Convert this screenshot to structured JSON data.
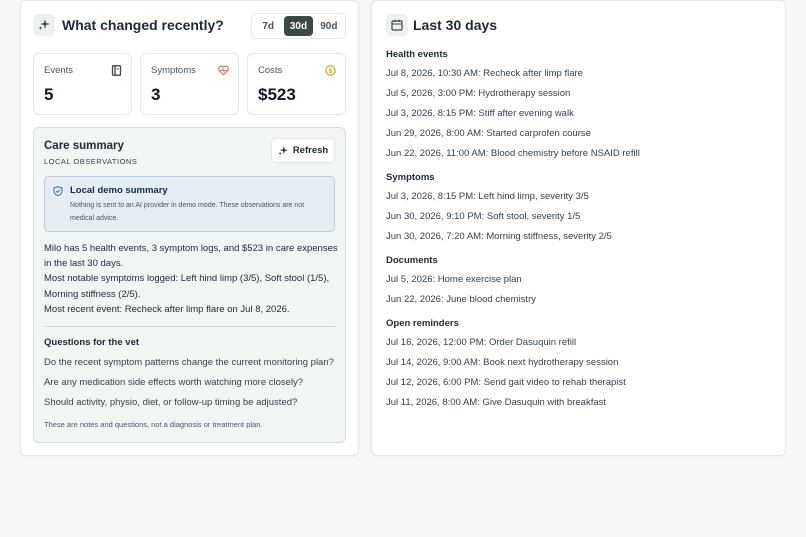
{
  "left": {
    "title": "What changed recently?",
    "range_options": [
      "7d",
      "30d",
      "90d"
    ],
    "range_selected": "30d",
    "metrics": [
      {
        "label": "Events",
        "value": "5",
        "icon": "book-icon",
        "color": "#3d4a44"
      },
      {
        "label": "Symptoms",
        "value": "3",
        "icon": "heart-pulse-icon",
        "color": "#e07a5f"
      },
      {
        "label": "Costs",
        "value": "$523",
        "icon": "coin-icon",
        "color": "#d4a017"
      }
    ],
    "care_summary": {
      "title": "Care summary",
      "subtitle": "LOCAL OBSERVATIONS",
      "refresh_label": "Refresh",
      "demo_title": "Local demo summary",
      "demo_text": "Nothing is sent to an AI provider in demo mode. These observations are not medical advice.",
      "summary_lines": [
        "Milo has 5 health events, 3 symptom logs, and $523 in care expenses in the last 30 days.",
        "Most notable symptoms logged: Left hind limp (3/5), Soft stool (1/5), Morning stiffness (2/5).",
        "Most recent event: Recheck after limp flare on Jul 8, 2026."
      ],
      "questions_title": "Questions for the vet",
      "questions": [
        "Do the recent symptom patterns change the current monitoring plan?",
        "Are any medication side effects worth watching more closely?",
        "Should activity, physio, diet, or follow-up timing be adjusted?"
      ],
      "footnote": "These are notes and questions, not a diagnosis or treatment plan."
    }
  },
  "right": {
    "title": "Last 30 days",
    "sections": [
      {
        "title": "Health events",
        "items": [
          "Jul 8, 2026, 10:30 AM: Recheck after limp flare",
          "Jul 5, 2026, 3:00 PM: Hydrotherapy session",
          "Jul 3, 2026, 8:15 PM: Stiff after evening walk",
          "Jun 29, 2026, 8:00 AM: Started carprofen course",
          "Jun 22, 2026, 11:00 AM: Blood chemistry before NSAID refill"
        ]
      },
      {
        "title": "Symptoms",
        "items": [
          "Jul 3, 2026, 8:15 PM: Left hind limp, severity 3/5",
          "Jun 30, 2026, 9:10 PM: Soft stool, severity 1/5",
          "Jun 30, 2026, 7:20 AM: Morning stiffness, severity 2/5"
        ]
      },
      {
        "title": "Documents",
        "items": [
          "Jul 5, 2026: Home exercise plan",
          "Jun 22, 2026: June blood chemistry"
        ]
      },
      {
        "title": "Open reminders",
        "items": [
          "Jul 16, 2026, 12:00 PM: Order Dasuquin refill",
          "Jul 14, 2026, 9:00 AM: Book next hydrotherapy session",
          "Jul 12, 2026, 6:00 PM: Send gait video to rehab therapist",
          "Jul 11, 2026, 8:00 AM: Give Dasuquin with breakfast"
        ]
      }
    ]
  }
}
